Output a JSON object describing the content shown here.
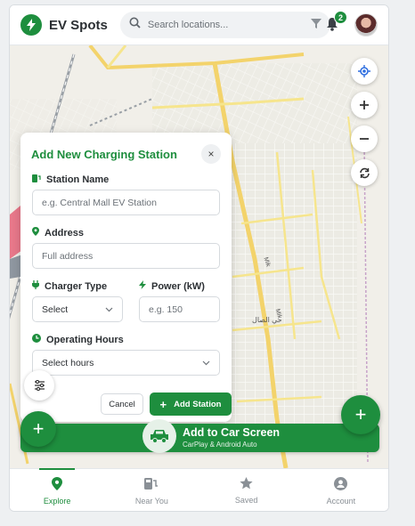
{
  "header": {
    "app_title": "EV Spots",
    "search_placeholder": "Search locations...",
    "notification_count": "2"
  },
  "modal": {
    "title": "Add New Charging Station",
    "close_glyph": "×",
    "station_name_label": "Station Name",
    "station_name_placeholder": "e.g. Central Mall EV Station",
    "address_label": "Address",
    "address_placeholder": "Full address",
    "charger_type_label": "Charger Type",
    "charger_type_value": "Select",
    "power_label": "Power (kW)",
    "power_placeholder": "e.g. 150",
    "hours_label": "Operating Hours",
    "hours_value": "Select hours",
    "cancel_label": "Cancel",
    "add_label": "Add Station"
  },
  "map": {
    "label_1": "حي الصال",
    "label_2": "Mik",
    "label_3": "Mik"
  },
  "car_screen": {
    "title": "Add to Car Screen",
    "subtitle": "CarPlay & Android Auto"
  },
  "nav": {
    "items": [
      {
        "label": "Explore",
        "icon": "map-pin-icon",
        "active": true
      },
      {
        "label": "Near You",
        "icon": "ev-charger-icon",
        "active": false
      },
      {
        "label": "Saved",
        "icon": "star-icon",
        "active": false
      },
      {
        "label": "Account",
        "icon": "user-icon",
        "active": false
      }
    ]
  },
  "colors": {
    "accent": "#1e8e3e",
    "road": "#f6e58d"
  }
}
